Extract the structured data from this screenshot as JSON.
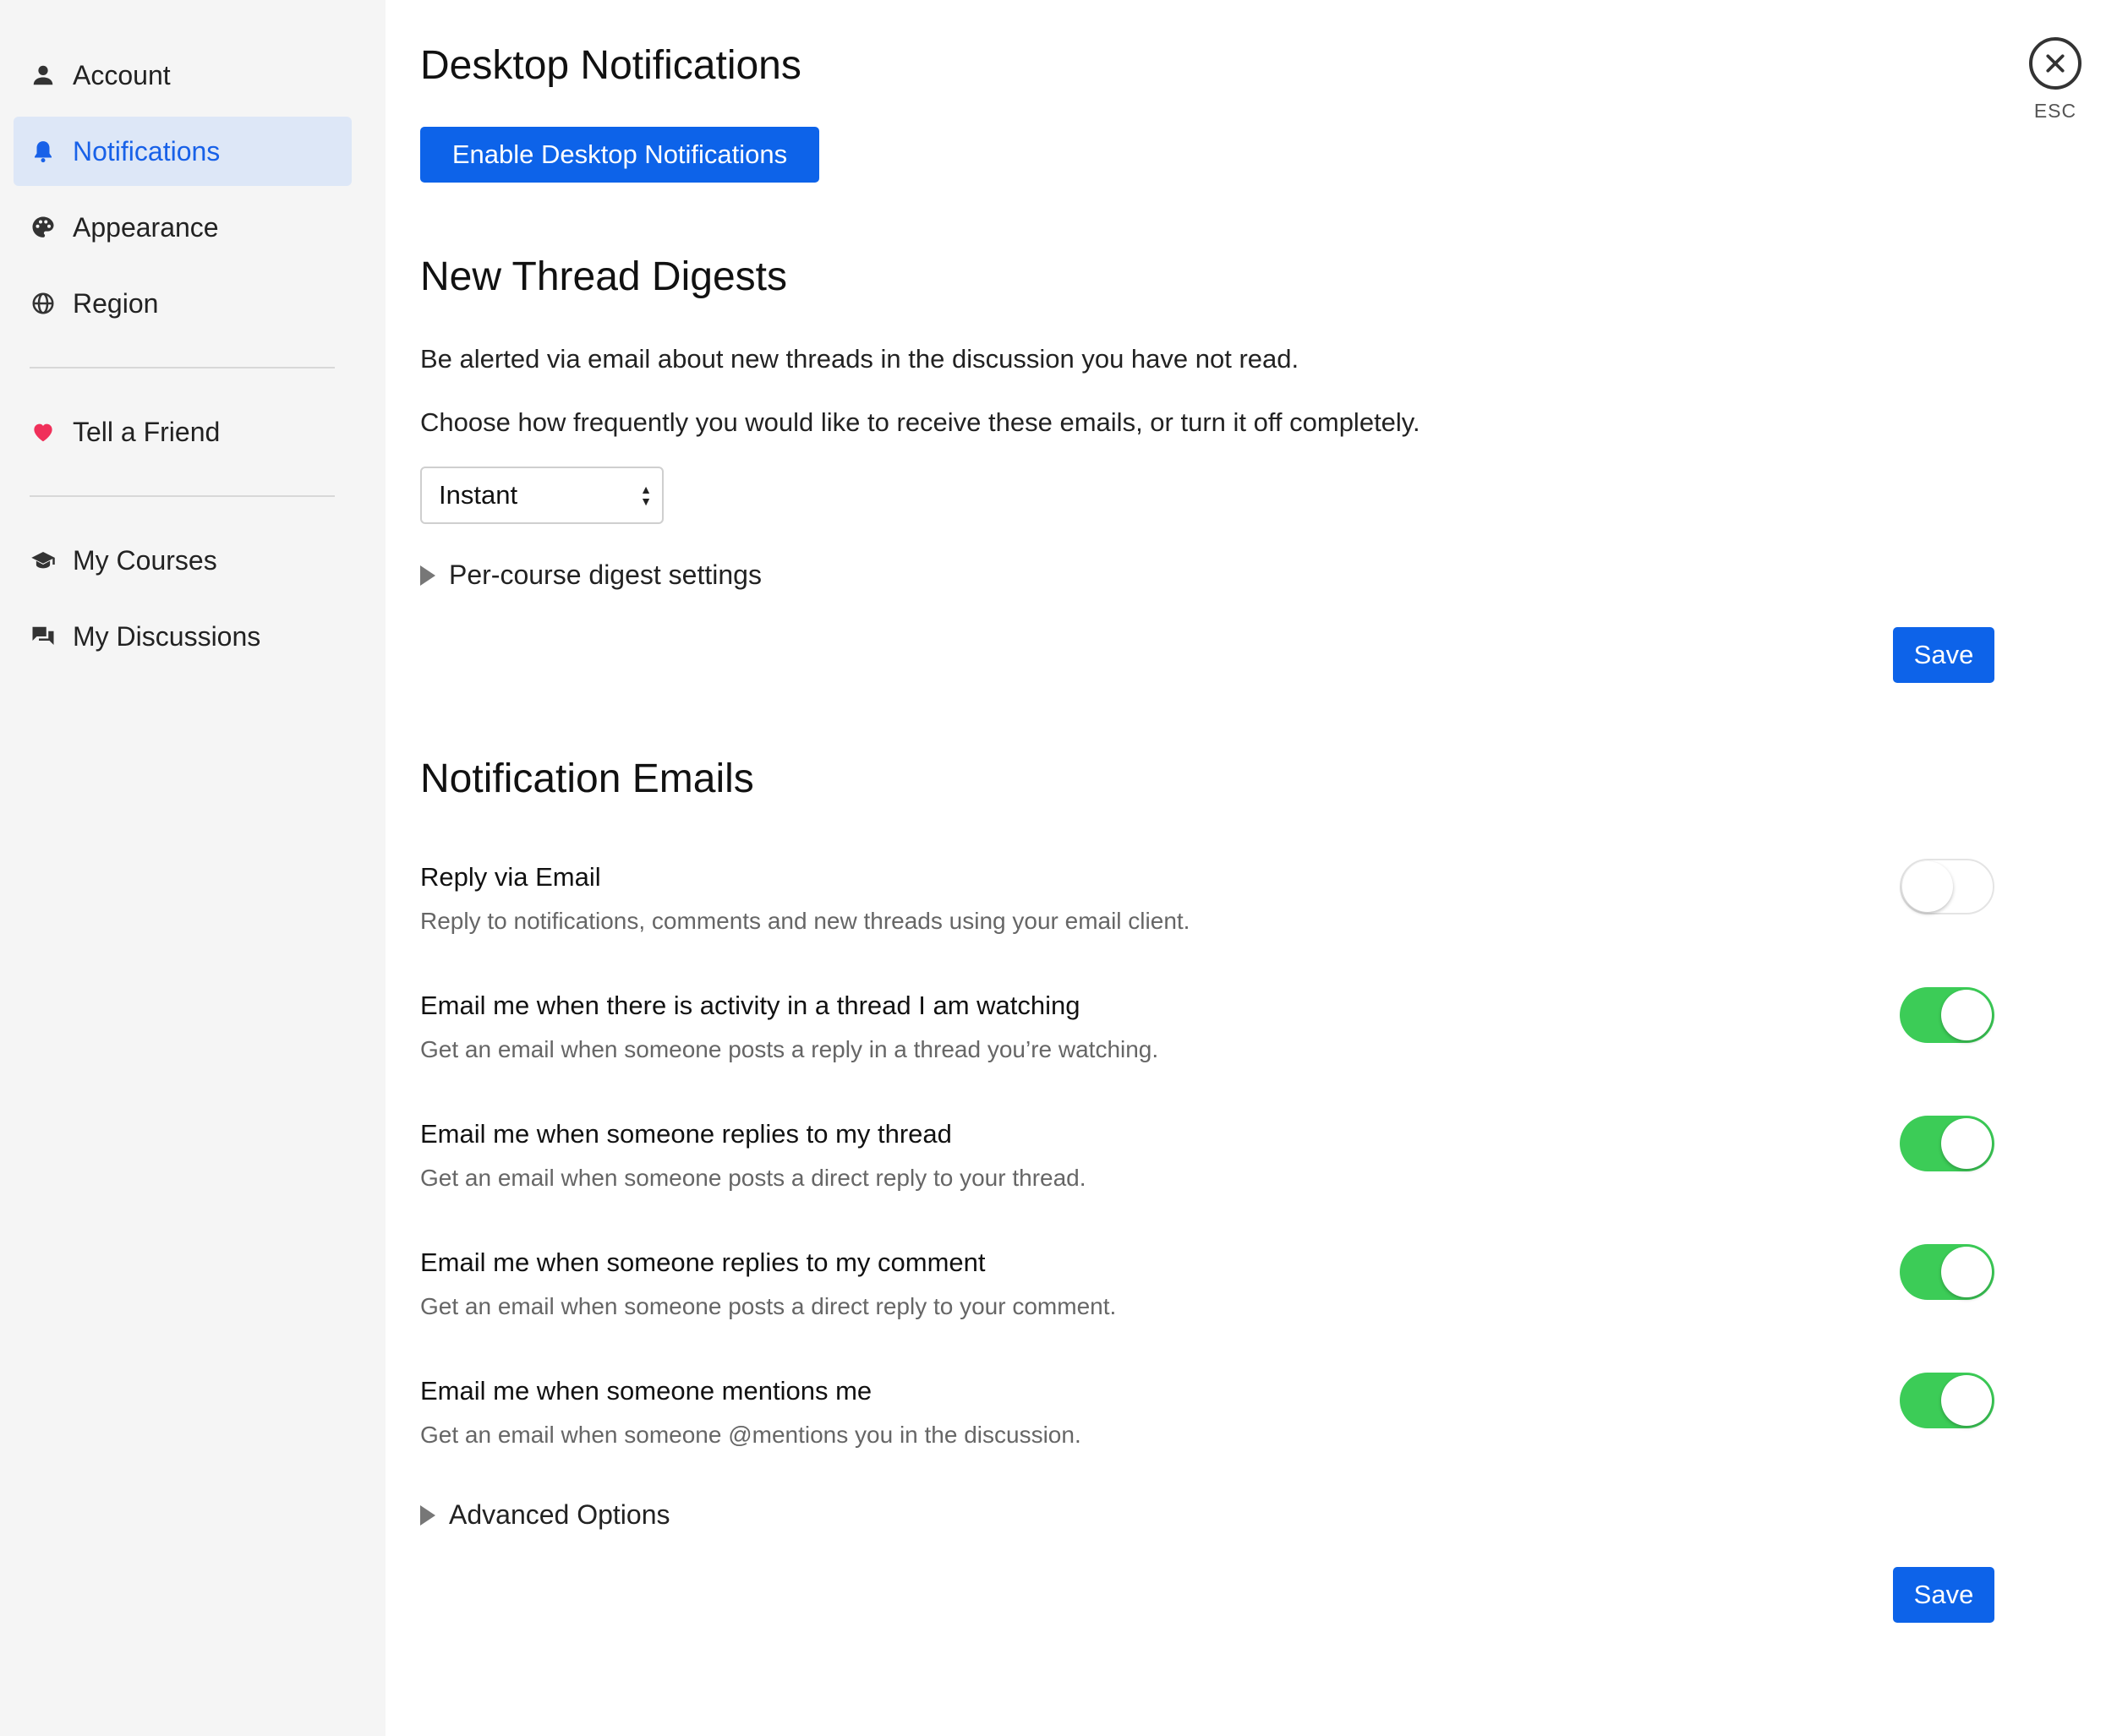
{
  "sidebar": {
    "items": [
      {
        "label": "Account",
        "icon": "person-icon",
        "active": false
      },
      {
        "label": "Notifications",
        "icon": "bell-icon",
        "active": true
      },
      {
        "label": "Appearance",
        "icon": "palette-icon",
        "active": false
      },
      {
        "label": "Region",
        "icon": "globe-icon",
        "active": false
      },
      {
        "label": "Tell a Friend",
        "icon": "heart-icon",
        "active": false
      },
      {
        "label": "My Courses",
        "icon": "graduation-cap-icon",
        "active": false
      },
      {
        "label": "My Discussions",
        "icon": "chat-bubbles-icon",
        "active": false
      }
    ]
  },
  "close": {
    "label": "ESC"
  },
  "desktop": {
    "title": "Desktop Notifications",
    "enable_label": "Enable Desktop Notifications"
  },
  "digest": {
    "title": "New Thread Digests",
    "description": "Be alerted via email about new threads in the discussion you have not read.",
    "prompt": "Choose how frequently you would like to receive these emails, or turn it off completely.",
    "frequency": "Instant",
    "per_course_label": "Per-course digest settings",
    "save_label": "Save"
  },
  "emails": {
    "title": "Notification Emails",
    "settings": [
      {
        "title": "Reply via Email",
        "description": "Reply to notifications, comments and new threads using your email client.",
        "enabled": false
      },
      {
        "title": "Email me when there is activity in a thread I am watching",
        "description": "Get an email when someone posts a reply in a thread you’re watching.",
        "enabled": true
      },
      {
        "title": "Email me when someone replies to my thread",
        "description": "Get an email when someone posts a direct reply to your thread.",
        "enabled": true
      },
      {
        "title": "Email me when someone replies to my comment",
        "description": "Get an email when someone posts a direct reply to your comment.",
        "enabled": true
      },
      {
        "title": "Email me when someone mentions me",
        "description": "Get an email when someone @mentions you in the discussion.",
        "enabled": true
      }
    ],
    "advanced_label": "Advanced Options",
    "save_label": "Save"
  },
  "colors": {
    "accent": "#0d63e9",
    "toggle_on": "#3ccc57",
    "active_nav_bg": "#dde7f7",
    "heart": "#f0305a"
  }
}
